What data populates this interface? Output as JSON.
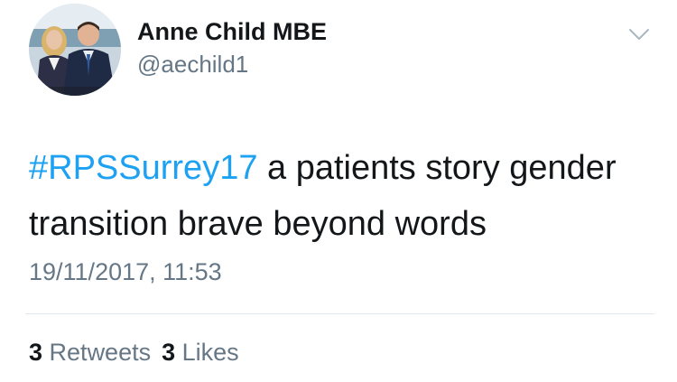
{
  "user": {
    "display_name": "Anne Child MBE",
    "handle": "@aechild1"
  },
  "tweet": {
    "hashtag": "#RPSSurrey17",
    "text": " a patients story gender transition brave beyond words",
    "timestamp": "19/11/2017, 11:53"
  },
  "stats": {
    "retweets_count": "3",
    "retweets_label": "Retweets",
    "likes_count": "3",
    "likes_label": "Likes"
  },
  "colors": {
    "link": "#1da1f2",
    "secondary_text": "#657786",
    "primary_text": "#14171a",
    "divider": "#e1e8ed"
  },
  "icons": {
    "menu": "chevron-down-icon"
  }
}
